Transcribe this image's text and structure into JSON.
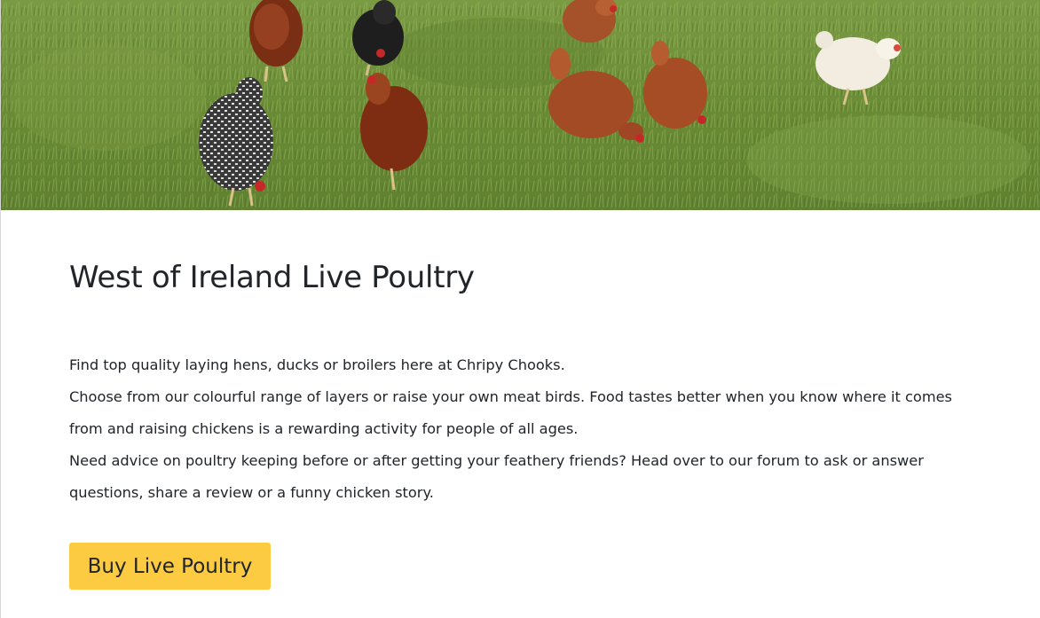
{
  "hero": {
    "image_icon": "chickens-in-grass-photo"
  },
  "main": {
    "title": "West of Ireland Live Poultry",
    "paragraphs": [
      "Find top quality laying hens, ducks or broilers here at Chripy Chooks.",
      "Choose from our colourful range of layers or raise your own meat birds. Food tastes better when you know where it comes from and raising chickens is a rewarding activity for people of all ages.",
      "Need advice on poultry keeping before or after getting your feathery friends? Head over to our forum to ask or answer questions, share a review or a funny chicken story."
    ],
    "cta_label": "Buy Live Poultry"
  },
  "colors": {
    "cta_background": "#fccb42",
    "text": "#212529",
    "grass": "#6f8f3a"
  }
}
